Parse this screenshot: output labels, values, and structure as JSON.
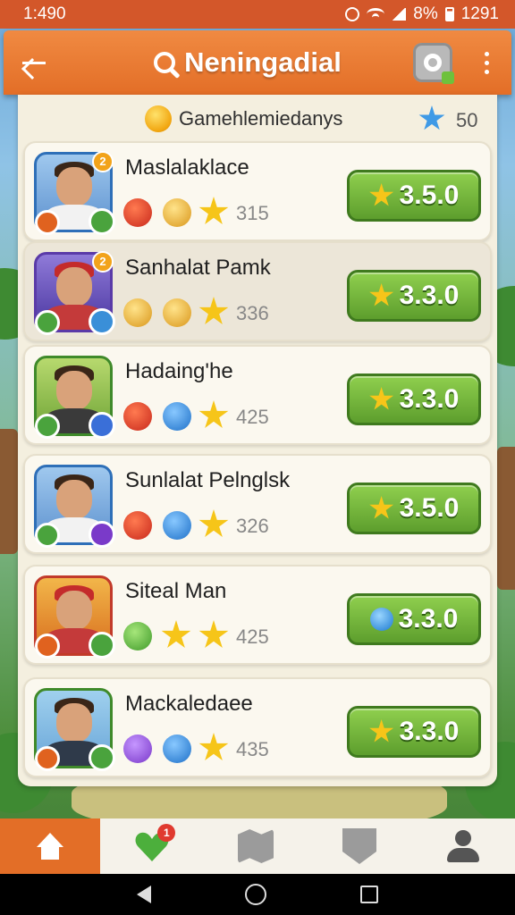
{
  "status_bar": {
    "time": "1:490",
    "battery_percent": "8%",
    "extra": "1291"
  },
  "app_bar": {
    "title": "Neningadial"
  },
  "panel": {
    "subtitle": "Gamehlemiedanys",
    "gem_count": "50"
  },
  "players": [
    {
      "name": "Maslalaklace",
      "count": "315",
      "score": "3.5.0",
      "rank": "2",
      "score_icon": "star-icon",
      "medals": [
        "red-medal-icon",
        "gold-star-medal-icon",
        "star-icon"
      ]
    },
    {
      "name": "Sanhalat Pamk",
      "count": "336",
      "score": "3.3.0",
      "rank": "2",
      "score_icon": "star-icon",
      "medals": [
        "gold-medal-icon",
        "gold-star-medal-icon",
        "star-icon"
      ]
    },
    {
      "name": "Hadaing'he",
      "count": "425",
      "score": "3.3.0",
      "rank": "",
      "score_icon": "star-icon",
      "medals": [
        "red-medal-icon",
        "blue-medal-icon",
        "star-icon"
      ]
    },
    {
      "name": "Sunlalat Pelnglsk",
      "count": "326",
      "score": "3.5.0",
      "rank": "",
      "score_icon": "star-icon",
      "medals": [
        "red-medal-icon",
        "blue-medal-icon",
        "star-icon"
      ]
    },
    {
      "name": "Siteal Man",
      "count": "425",
      "score": "3.3.0",
      "rank": "",
      "score_icon": "blue-gem-icon",
      "medals": [
        "green-medal-icon",
        "star-icon",
        "star-icon"
      ]
    },
    {
      "name": "Mackaledaee",
      "count": "435",
      "score": "3.3.0",
      "rank": "",
      "score_icon": "star-icon",
      "medals": [
        "purple-medal-icon",
        "blue-medal-icon",
        "star-icon"
      ]
    }
  ],
  "bottom_nav": {
    "items": [
      "home-icon",
      "heart-icon",
      "map-icon",
      "shield-icon",
      "profile-icon"
    ],
    "notification_count": "1"
  },
  "colors": {
    "accent": "#e36e27",
    "score_button": "#5d9e2d",
    "panel": "#f4efdf"
  }
}
